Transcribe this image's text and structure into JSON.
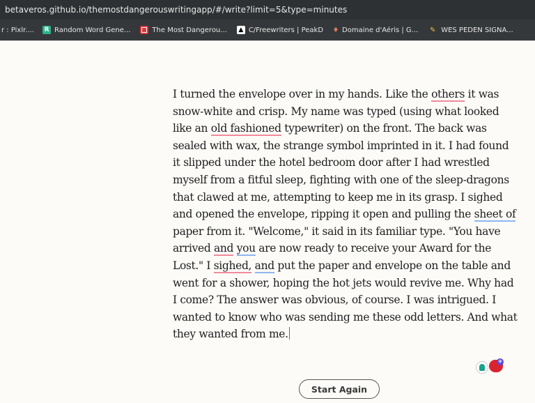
{
  "browser": {
    "url": "betaveros.github.io/themostdangerouswritingapp/#/write?limit=5&type=minutes",
    "bookmarks": [
      {
        "label": "r : Pixlr....",
        "icon": "none"
      },
      {
        "label": "Random Word Gene...",
        "icon": "r-logo-icon"
      },
      {
        "label": "The Most Dangerou...",
        "icon": "mdwa-logo-icon"
      },
      {
        "label": "C/Freewriters | PeakD",
        "icon": "peakd-logo-icon"
      },
      {
        "label": "Domaine d'Aéris | G...",
        "icon": "aeris-logo-icon"
      },
      {
        "label": "WES PEDEN SIGNA...",
        "icon": "wes-logo-icon"
      }
    ]
  },
  "editor": {
    "lines": [
      [
        "I turned the envelope over in my hands. Like the ",
        {
          "t": "others",
          "u": "red"
        },
        " it was"
      ],
      [
        "snow-white and crisp. My name was typed (using what looked"
      ],
      [
        "like an ",
        {
          "t": "old fashioned",
          "u": "red"
        },
        " typewriter) on the front. The back was"
      ],
      [
        "sealed with wax, the strange symbol imprinted in it. I had found"
      ],
      [
        "it slipped under the hotel bedroom door after I had wrestled"
      ],
      [
        "myself from a fitful sleep, fighting with one of the sleep-dragons"
      ],
      [
        "that clawed at me, attempting to keep me in its grasp. I sighed"
      ],
      [
        "and opened the envelope, ripping it open and pulling the ",
        {
          "t": "sheet of",
          "u": "blue"
        }
      ],
      [
        "paper from it. \"Welcome,\" it said in its familiar type. \"You have"
      ],
      [
        "arrived ",
        {
          "t": "and",
          "u": "red"
        },
        " ",
        {
          "t": "you",
          "u": "blue"
        },
        " are now ready to receive your Award for the"
      ],
      [
        "Lost.\" I ",
        {
          "t": "sighed,",
          "u": "red"
        },
        " ",
        {
          "t": "and",
          "u": "blue"
        },
        " put the paper and envelope on the table and"
      ],
      [
        "went for a shower, hoping the hot jets would revive me. Why had"
      ],
      [
        "I come? The answer was obvious, of course. I was intrigued. I"
      ],
      [
        "wanted to know who was sending me these odd letters. And what"
      ],
      [
        "they wanted from me."
      ]
    ]
  },
  "actions": {
    "start_again_label": "Start Again"
  },
  "colors": {
    "page_background": "#fcfbf8",
    "spell_underline": "#f08a9c",
    "grammar_underline": "#8fb6ef",
    "caret": "#e03a3a"
  }
}
